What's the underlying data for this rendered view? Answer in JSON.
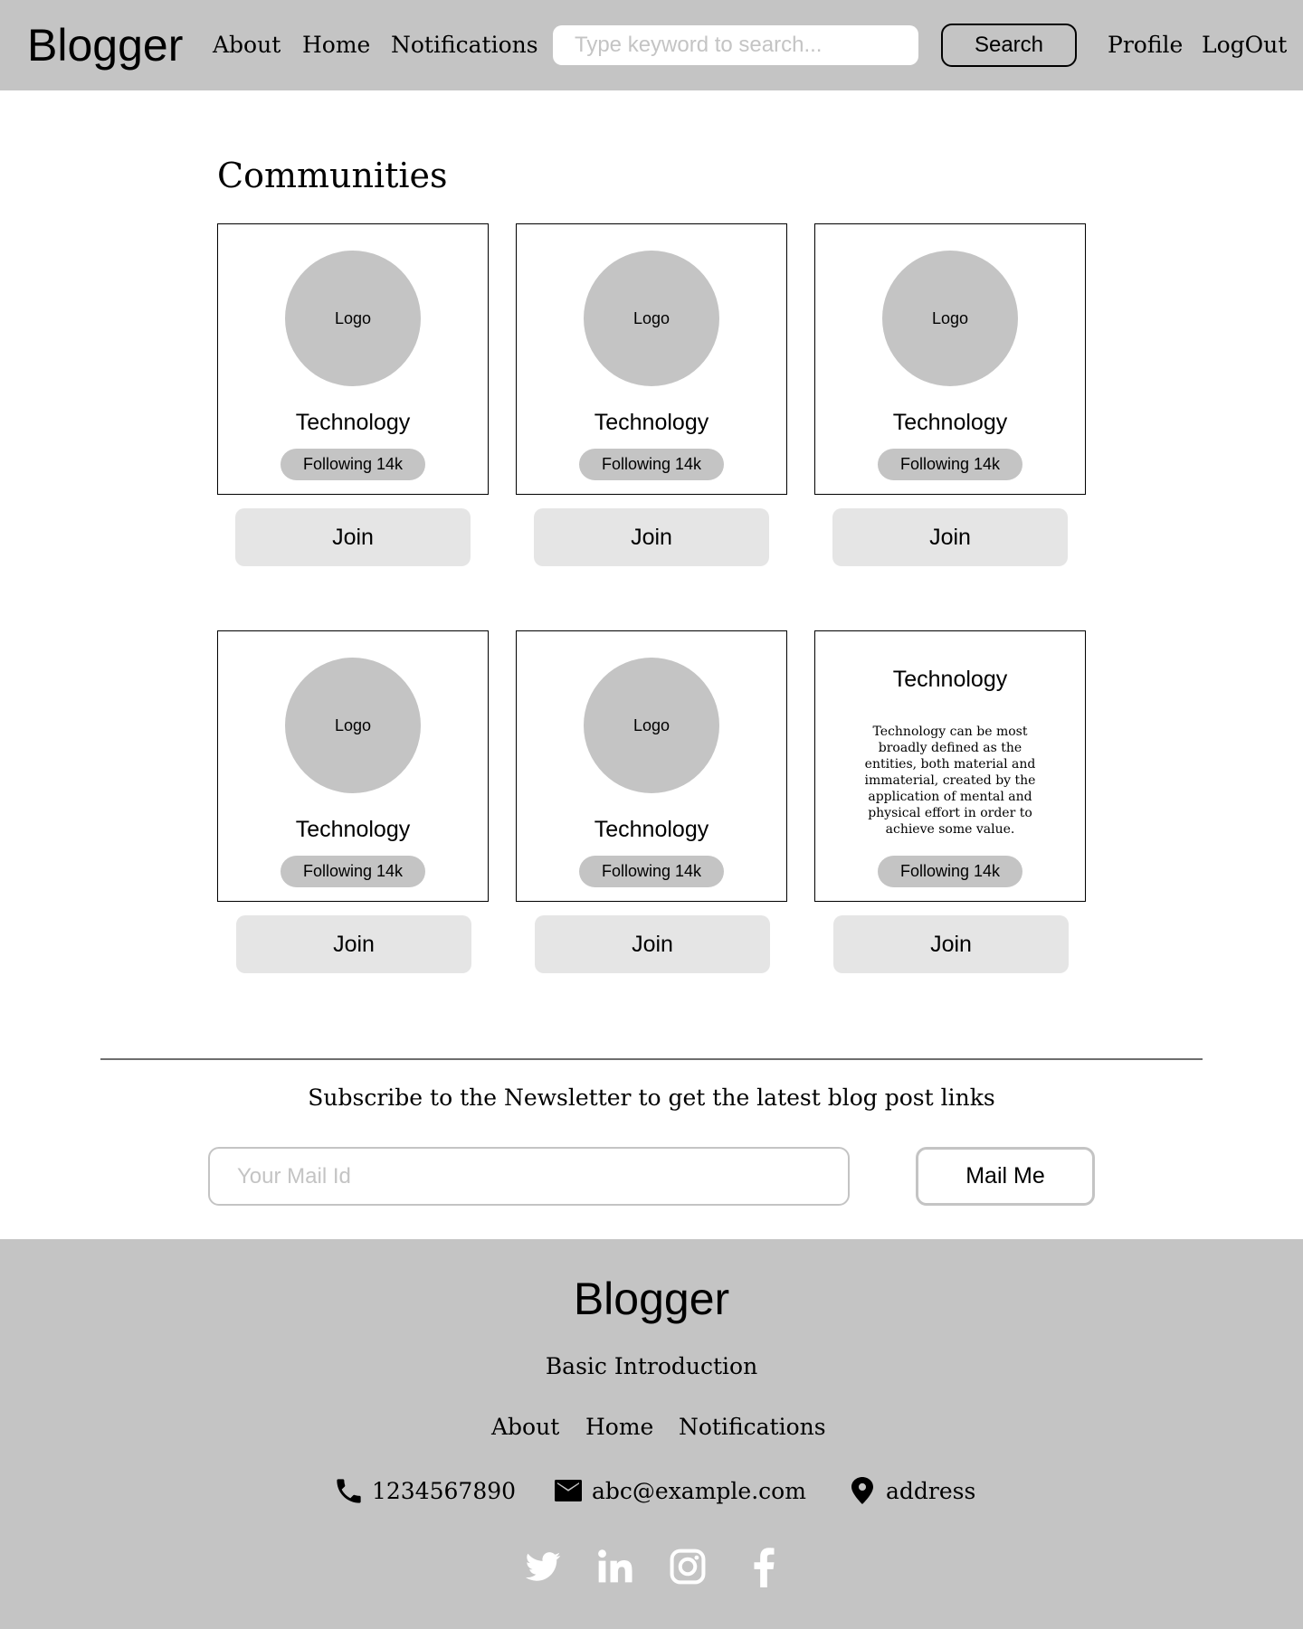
{
  "header": {
    "brand": "Blogger",
    "nav": [
      "About",
      "Home",
      "Notifications"
    ],
    "search_placeholder": "Type keyword to search...",
    "search_button": "Search",
    "profile": "Profile",
    "logout": "LogOut"
  },
  "main": {
    "title": "Communities",
    "cards": [
      {
        "logo": "Logo",
        "name": "Technology",
        "following": "Following 14k",
        "join": "Join"
      },
      {
        "logo": "Logo",
        "name": "Technology",
        "following": "Following 14k",
        "join": "Join"
      },
      {
        "logo": "Logo",
        "name": "Technology",
        "following": "Following 14k",
        "join": "Join"
      },
      {
        "logo": "Logo",
        "name": "Technology",
        "following": "Following 14k",
        "join": "Join"
      },
      {
        "logo": "Logo",
        "name": "Technology",
        "following": "Following 14k",
        "join": "Join"
      },
      {
        "name": "Technology",
        "description": "Technology can be most broadly defined as the entities, both material and immaterial, created by the application of mental and physical effort in order to achieve some value.",
        "following": "Following 14k",
        "join": "Join"
      }
    ]
  },
  "newsletter": {
    "text": "Subscribe to the Newsletter to get the latest blog post links",
    "placeholder": "Your Mail Id",
    "button": "Mail Me"
  },
  "footer": {
    "brand": "Blogger",
    "intro": "Basic Introduction",
    "links": [
      "About",
      "Home",
      "Notifications"
    ],
    "phone": "1234567890",
    "email": "abc@example.com",
    "address": "address",
    "social_icons": [
      "twitter-icon",
      "linkedin-icon",
      "instagram-icon",
      "facebook-icon"
    ]
  }
}
